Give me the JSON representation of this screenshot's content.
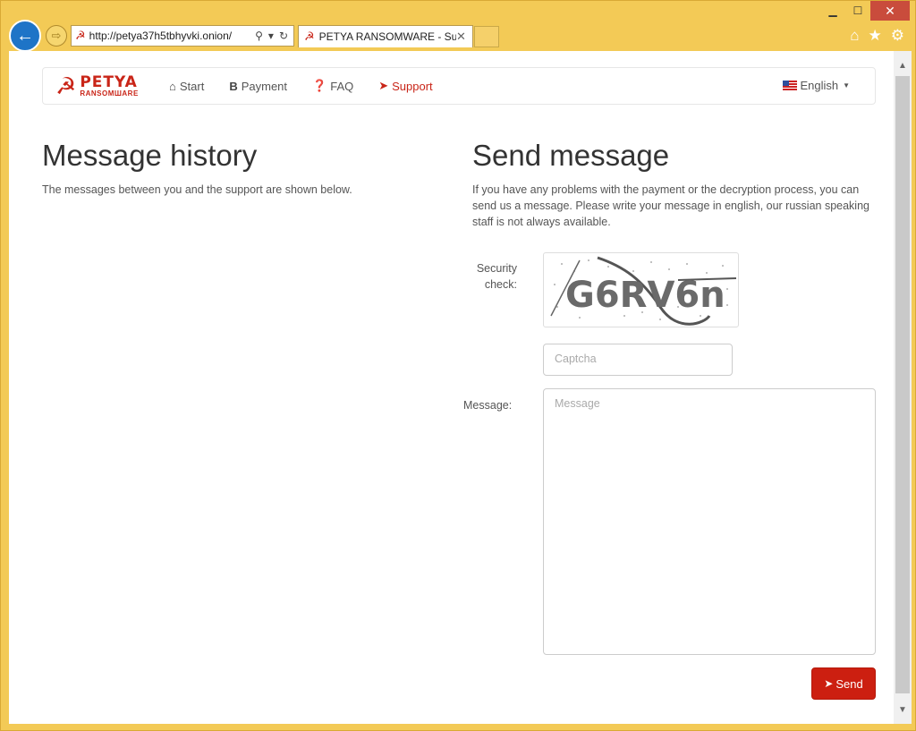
{
  "browser": {
    "address_url": "http://petya37h5tbhyvki.onion/",
    "tab_title": "PETYA RANSOMWARE - Su...",
    "close_tab": "✕",
    "icons": {
      "back": "arrow-left-icon",
      "forward": "arrow-right-icon",
      "search": "search-icon",
      "refresh": "refresh-icon",
      "home": "home-icon",
      "favorites": "star-icon",
      "settings": "gear-icon"
    }
  },
  "site": {
    "brand": {
      "word1": "PETYA",
      "word2": "RANSOMШARE"
    },
    "nav": [
      {
        "label": "Start",
        "icon": "home-icon"
      },
      {
        "label": "Payment",
        "icon": "bitcoin-icon"
      },
      {
        "label": "FAQ",
        "icon": "question-circle-icon"
      },
      {
        "label": "Support",
        "icon": "paper-plane-icon"
      }
    ],
    "language": "English"
  },
  "history": {
    "heading": "Message history",
    "description": "The messages between you and the support are shown below."
  },
  "send": {
    "heading": "Send message",
    "description": "If you have any problems with the payment or the decryption process, you can send us a message. Please write your message in english, our russian speaking staff is not always available.",
    "security_label_line1": "Security",
    "security_label_line2": "check:",
    "captcha_text": "G6RV6n",
    "captcha_placeholder": "Captcha",
    "message_label": "Message:",
    "message_placeholder": "Message",
    "send_label": "Send"
  },
  "colors": {
    "accent": "#cc1f10",
    "chrome": "#f3ca56"
  }
}
